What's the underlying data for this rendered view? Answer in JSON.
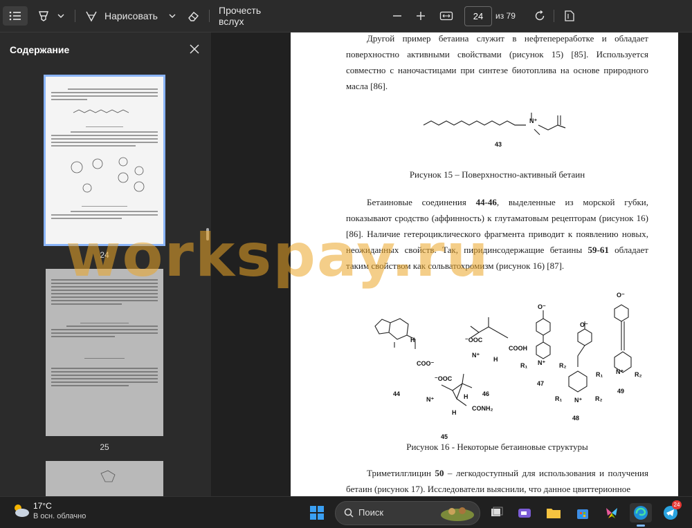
{
  "toolbar": {
    "draw_label": "Нарисовать",
    "read_aloud_label": "Прочесть вслух",
    "page_value": "24",
    "page_total": "из 79"
  },
  "sidebar": {
    "title": "Содержание",
    "thumbnails": [
      {
        "page": "24",
        "selected": true
      },
      {
        "page": "25",
        "selected": false
      }
    ]
  },
  "document": {
    "para1": "Другой пример бетаина служит в нефтепереработке и обладает поверхностно активными свойствами (рисунок 15) [85]. Используется совместно с наночастицами при синтезе биотоплива на основе природного масла [86].",
    "compound_43": "43",
    "caption15": "Рисунок 15 – Поверхностно-активный бетаин",
    "para2": {
      "t1": "Бетаиновые соединения ",
      "b1": "44-46",
      "t2": ", выделенные из морской губки, показывают сродство (аффинность) к глутаматовым рецепторам (рисунок 16) [86]. Наличие гетероциклического фрагмента приводит к появлению новых, неожиданных свойств. Так, пиридинсодержащие бетаины ",
      "b2": "59-61",
      "t3": " обладает таким свойством как сольватохромизм (рисунок 16) [87]."
    },
    "structures": {
      "c44": "44",
      "c45": "45",
      "c46": "46",
      "c47": "47",
      "c48": "48",
      "c49": "49",
      "coo_minus": "COO⁻",
      "ooc_minus": "⁻OOC",
      "cooh": "COOH",
      "conh2": "CONH₂",
      "h": "H",
      "o_minus": "O⁻",
      "n_plus": "N⁺",
      "r1": "R₁",
      "r2": "R₂"
    },
    "caption16": "Рисунок 16 - Некоторые бетаиновые структуры",
    "para3": {
      "t1": "Триметилглицин ",
      "b1": "50",
      "t2": " – легкодоступный для использования и получения бетаин (рисунок 17). Исследователи выяснили, что данное цвиттерионное"
    },
    "watermark": "workspay.ru"
  },
  "taskbar": {
    "weather_temp": "17°C",
    "weather_desc": "В осн. облачно",
    "search_label": "Поиск",
    "telegram_badge": "24"
  }
}
